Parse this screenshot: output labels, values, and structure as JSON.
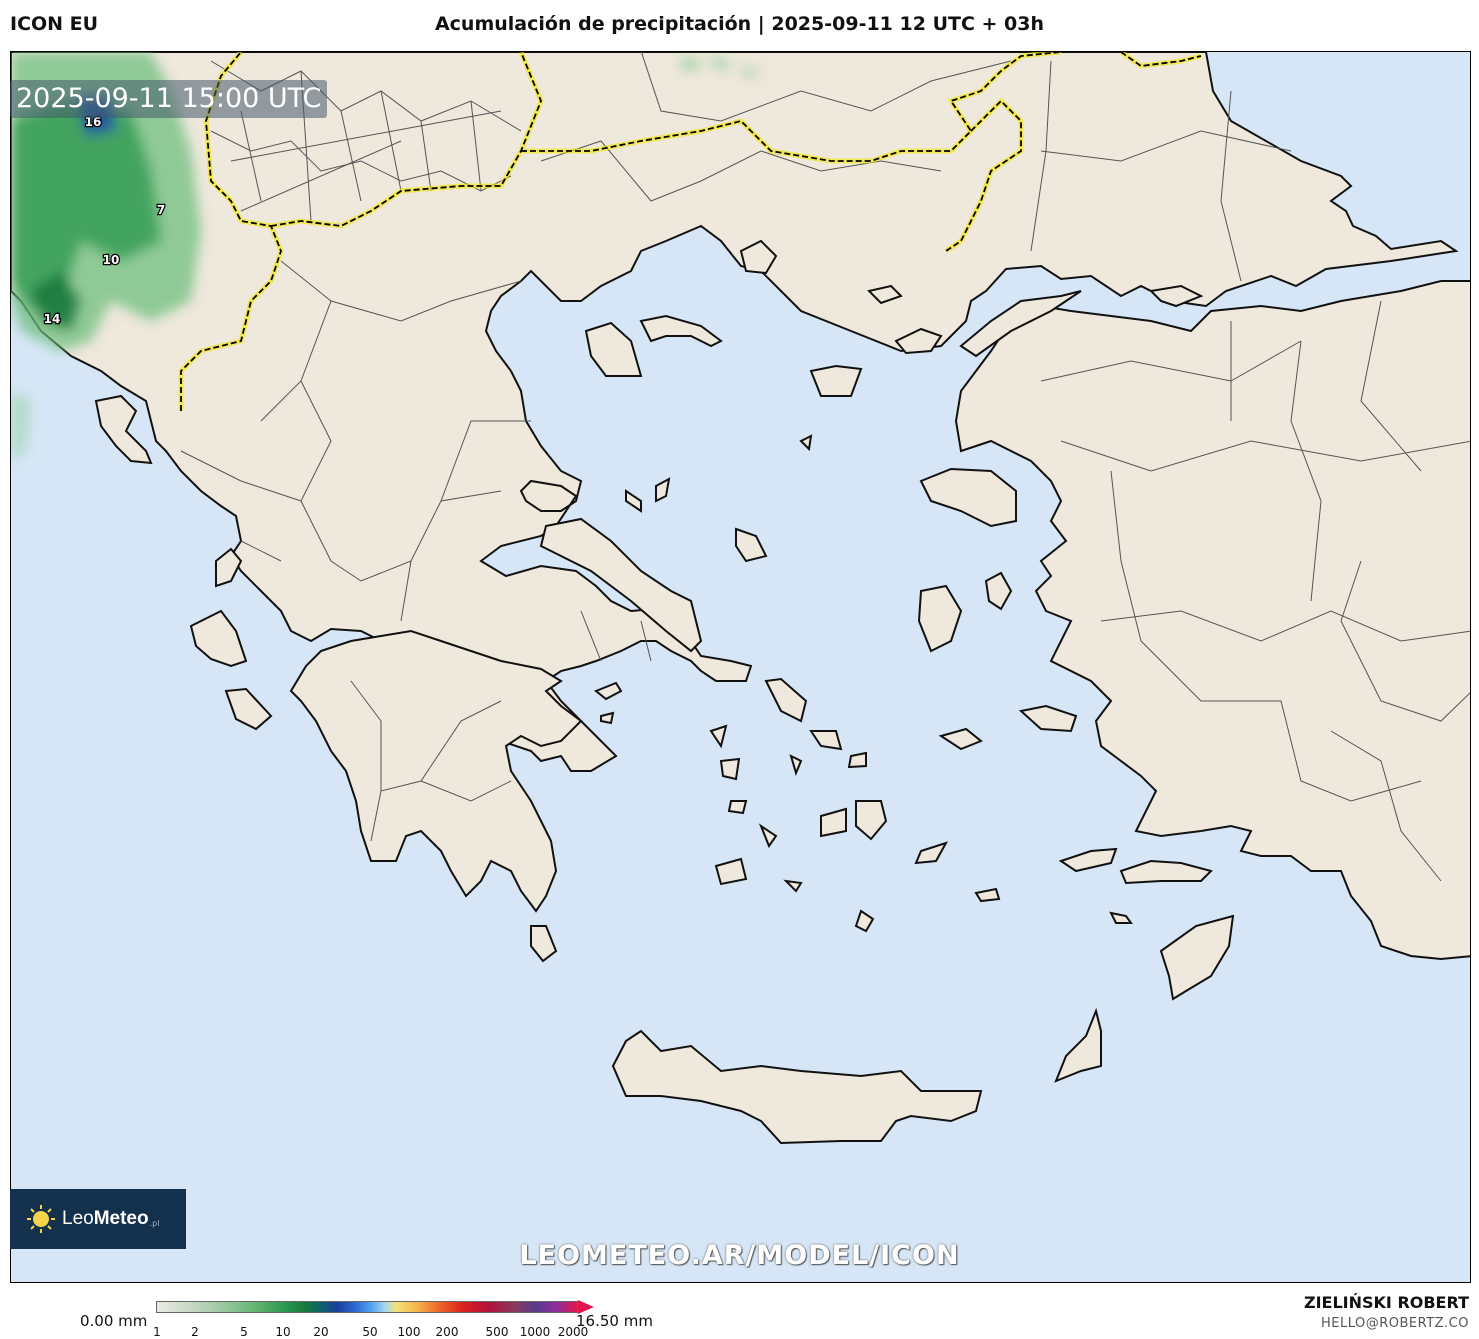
{
  "header": {
    "model": "ICON EU",
    "title": "Acumulación de precipitación | 2025-09-11 12 UTC + 03h"
  },
  "map": {
    "timestamp": "2025-09-11 15:00 UTC",
    "watermark": "LEOMETEO.AR/MODEL/ICON",
    "precip_labels": [
      "16",
      "7",
      "10",
      "14"
    ],
    "colors": {
      "sea": "#d6e6f6",
      "land": "#efe8dc",
      "border_highlight": "#f2e600",
      "precip_green": "#2e9a52",
      "precip_blue": "#1f4fa8"
    }
  },
  "logo": {
    "brand_light": "Leo",
    "brand_bold": "Meteo",
    "suffix": ".pl"
  },
  "colorbar": {
    "min_label": "0.00 mm",
    "max_label": "16.50 mm",
    "ticks": [
      "1",
      "2",
      "5",
      "10",
      "20",
      "50",
      "100",
      "200",
      "500",
      "1000",
      "2000"
    ]
  },
  "author": {
    "name": "ZIELIŃSKI ROBERT",
    "email": "HELLO@ROBERTZ.CO"
  }
}
